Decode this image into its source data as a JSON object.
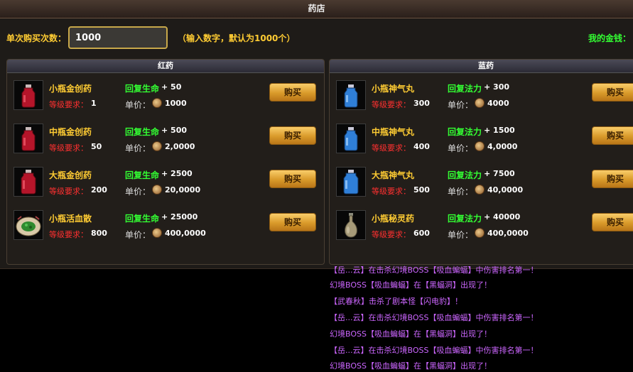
{
  "window": {
    "title": "药店"
  },
  "purchase": {
    "qty_label": "单次购买次数：",
    "qty_value": "1000",
    "hint": "（输入数字，默认为1000个）",
    "money_label": "我的金钱："
  },
  "red_panel": {
    "title": "红药",
    "items": [
      {
        "name": "小瓶金创药",
        "level_label": "等级要求：",
        "level": "1",
        "effect_label": "回复生命",
        "effect_value": "+ 50",
        "price_label": "单价：",
        "price": "1000",
        "buy_label": "购买",
        "icon": "red-potion-small-icon"
      },
      {
        "name": "中瓶金创药",
        "level_label": "等级要求：",
        "level": "50",
        "effect_label": "回复生命",
        "effect_value": "+ 500",
        "price_label": "单价：",
        "price": "2,0000",
        "buy_label": "购买",
        "icon": "red-potion-medium-icon"
      },
      {
        "name": "大瓶金创药",
        "level_label": "等级要求：",
        "level": "200",
        "effect_label": "回复生命",
        "effect_value": "+ 2500",
        "price_label": "单价：",
        "price": "20,0000",
        "buy_label": "购买",
        "icon": "red-potion-large-icon"
      },
      {
        "name": "小瓶活血散",
        "level_label": "等级要求：",
        "level": "800",
        "effect_label": "回复生命",
        "effect_value": "+ 25000",
        "price_label": "单价：",
        "price": "400,0000",
        "buy_label": "购买",
        "icon": "herb-powder-icon"
      }
    ]
  },
  "blue_panel": {
    "title": "蓝药",
    "items": [
      {
        "name": "小瓶神气丸",
        "level_label": "等级要求：",
        "level": "300",
        "effect_label": "回复法力",
        "effect_value": "+ 300",
        "price_label": "单价：",
        "price": "4000",
        "buy_label": "购买",
        "icon": "blue-potion-small-icon"
      },
      {
        "name": "中瓶神气丸",
        "level_label": "等级要求：",
        "level": "400",
        "effect_label": "回复法力",
        "effect_value": "+ 1500",
        "price_label": "单价：",
        "price": "4,0000",
        "buy_label": "购买",
        "icon": "blue-potion-medium-icon"
      },
      {
        "name": "大瓶神气丸",
        "level_label": "等级要求：",
        "level": "500",
        "effect_label": "回复法力",
        "effect_value": "+ 7500",
        "price_label": "单价：",
        "price": "40,0000",
        "buy_label": "购买",
        "icon": "blue-potion-large-icon"
      },
      {
        "name": "小瓶秘灵药",
        "level_label": "等级要求：",
        "level": "600",
        "effect_label": "回复法力",
        "effect_value": "+ 40000",
        "price_label": "单价：",
        "price": "400,0000",
        "buy_label": "购买",
        "icon": "vase-potion-icon"
      }
    ]
  },
  "chat": {
    "lines": [
      "【岳...云】在击杀幻境BOSS【吸血蝙蝠】中伤害排名第一！",
      "幻境BOSS【吸血蝙蝠】在【黑蝠洞】出现了！",
      "【武春秋】击杀了剧本怪【闪电豹】！",
      "【岳...云】在击杀幻境BOSS【吸血蝙蝠】中伤害排名第一！",
      "幻境BOSS【吸血蝙蝠】在【黑蝠洞】出现了！",
      "【岳...云】在击杀幻境BOSS【吸血蝙蝠】中伤害排名第一！",
      "幻境BOSS【吸血蝙蝠】在【黑蝠洞】出现了！"
    ]
  },
  "colors": {
    "gold_text": "#ffcc33",
    "green_text": "#33ff33",
    "red_text": "#ff3030",
    "chat_purple": "#cc66ff"
  }
}
